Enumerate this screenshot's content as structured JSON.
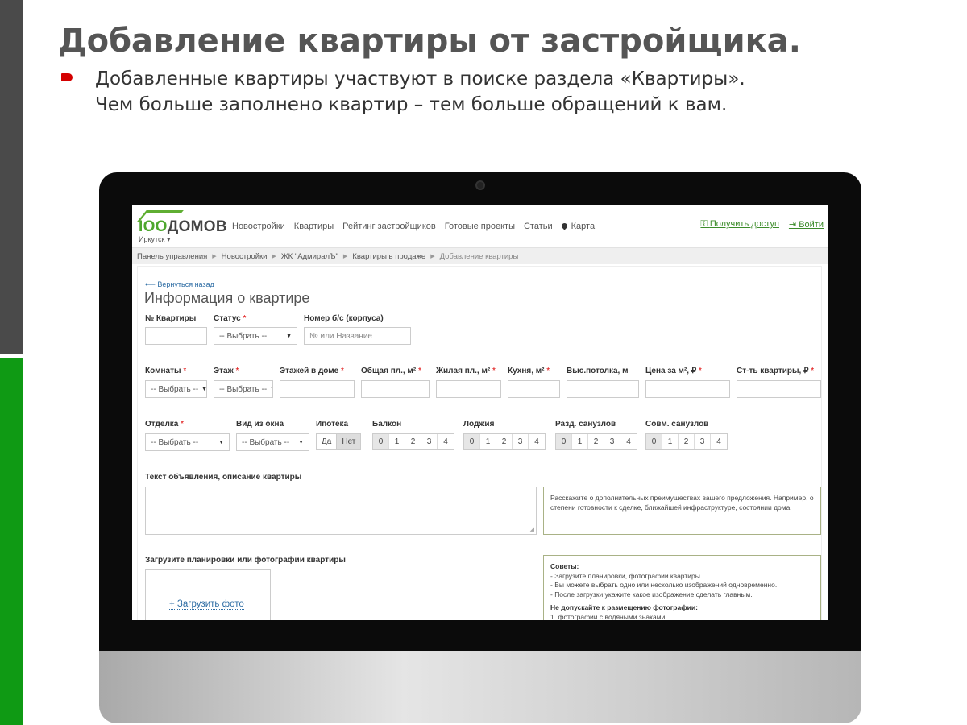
{
  "slide": {
    "title": "Добавление квартиры от застройщика.",
    "bullet_line1": "Добавленные квартиры участвуют в поиске раздела «Квартиры».",
    "bullet_line2": "Чем больше заполнено квартир – тем больше обращений к вам."
  },
  "site": {
    "logo_a": "IOO",
    "logo_b": "ДОМОВ",
    "city": "Иркутск ▾",
    "nav": [
      "Новостройки",
      "Квартиры",
      "Рейтинг застройщиков",
      "Готовые проекты",
      "Статьи",
      "Карта"
    ],
    "get_access": "Получить доступ",
    "login": "Войти"
  },
  "breadcrumb": [
    "Панель управления",
    "Новостройки",
    "ЖК \"АдмиралЪ\"",
    "Квартиры в продаже",
    "Добавление квартиры"
  ],
  "form": {
    "back": "⟵ Вернуться назад",
    "heading": "Информация о квартире",
    "apt_no": "№ Квартиры",
    "status": "Статус",
    "status_value": "-- Выбрать --",
    "building": "Номер б/с (корпуса)",
    "building_placeholder": "№ или Название",
    "rooms": "Комнаты",
    "floor": "Этаж",
    "floors_total": "Этажей в доме",
    "area_total": "Общая пл., м²",
    "area_living": "Жилая пл., м²",
    "kitchen": "Кухня, м²",
    "ceiling": "Выс.потолка, м",
    "price_m2": "Цена за м², ₽",
    "price_total": "Ст-ть квартиры, ₽",
    "rooms_value": "-- Выбрать --",
    "floor_value": "-- Выбрать --",
    "finish": "Отделка",
    "view": "Вид из окна",
    "mortgage": "Ипотека",
    "balcony": "Балкон",
    "loggia": "Лоджия",
    "bath_sep": "Разд. санузлов",
    "bath_comb": "Совм. санузлов",
    "finish_value": "-- Выбрать --",
    "view_value": "-- Выбрать --",
    "yes": "Да",
    "no": "Нет",
    "counts": [
      "0",
      "1",
      "2",
      "3",
      "4"
    ],
    "description_label": "Текст объявления, описание квартиры",
    "description_hint": "Расскажите о дополнительных преимуществах вашего предложения. Например, о степени готовности к сделке, ближайшей инфраструктуре, состоянии дома.",
    "upload_label": "Загрузите планировки или фотографии квартиры",
    "upload_link": "+ Загрузить фото",
    "tips_title": "Советы:",
    "tips": [
      "- Загрузите планировки, фотографии квартиры.",
      "- Вы можете выбрать одно или несколько изображений одновременно.",
      "- После загрузки укажите какое изображение сделать главным."
    ],
    "forbidden_title": "Не допускайте к размещению фотографии:",
    "forbidden_1": "1. фотографии с водяными знаками"
  }
}
